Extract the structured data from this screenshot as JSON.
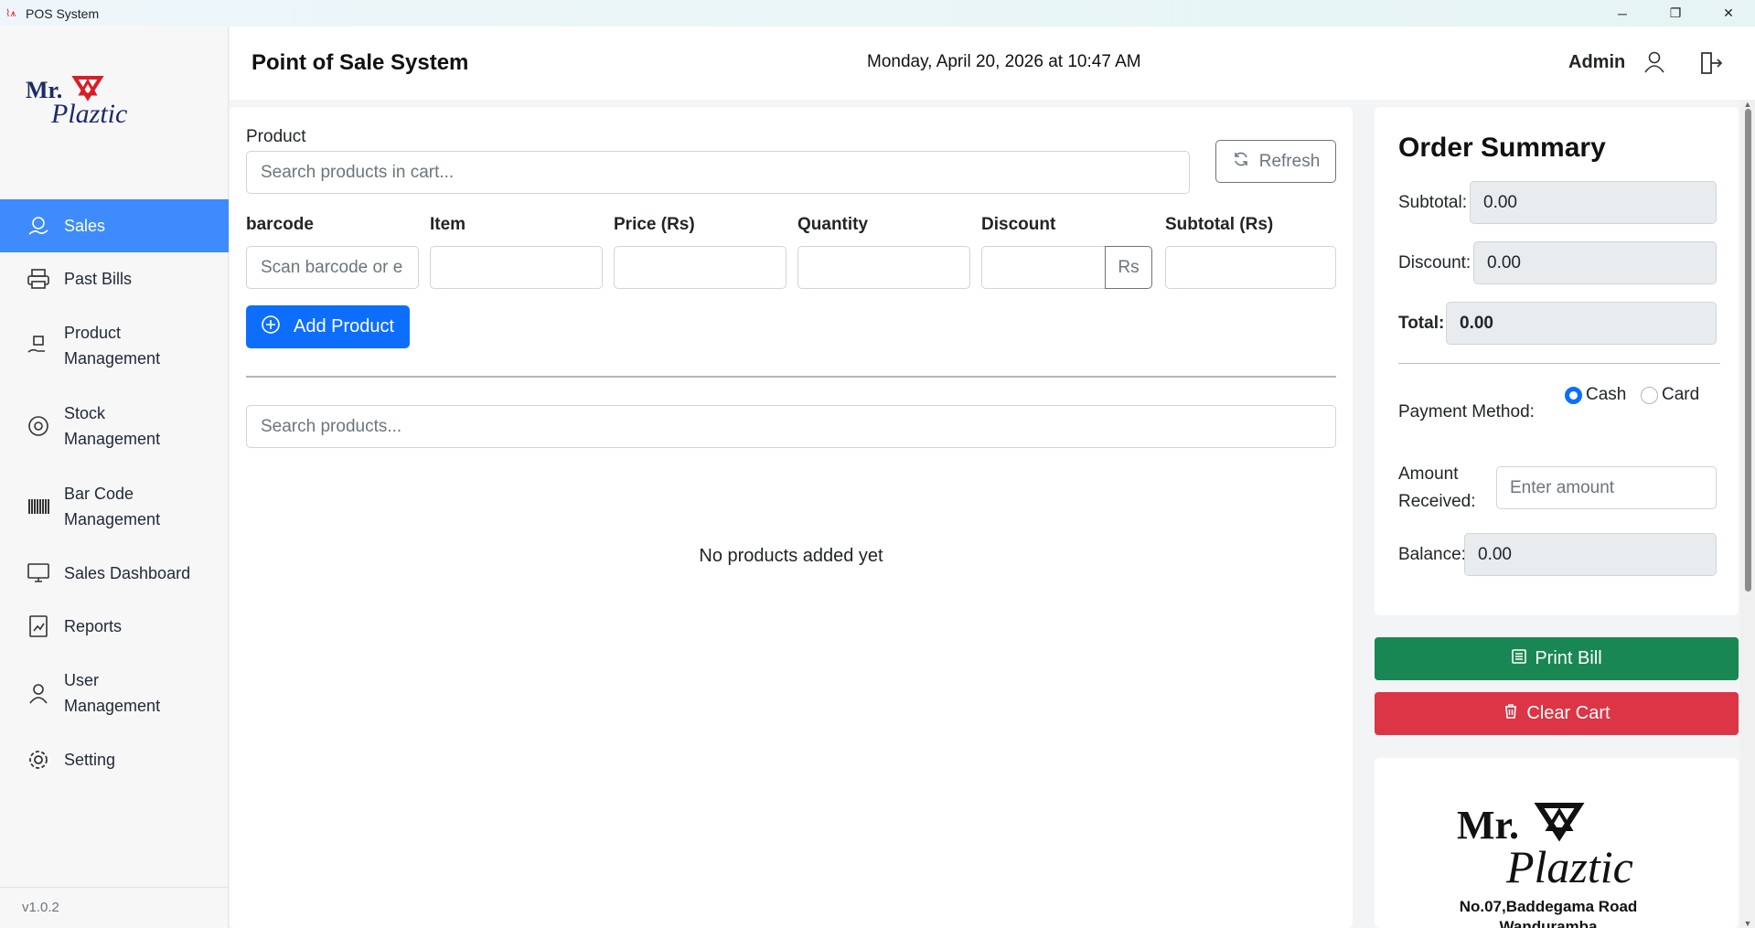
{
  "window": {
    "title": "POS System",
    "minimize": "─",
    "maximize": "❐",
    "close": "✕"
  },
  "sidebar": {
    "brand_top": "Mr.",
    "brand_bottom": "Plaztic",
    "items": [
      {
        "label": "Sales",
        "icon": "sales-icon",
        "active": true
      },
      {
        "label": "Past Bills",
        "icon": "printer-icon"
      },
      {
        "label": "Product\nManagement",
        "icon": "product-icon"
      },
      {
        "label": "Stock\nManagement",
        "icon": "stock-icon"
      },
      {
        "label": "Bar Code\nManagement",
        "icon": "barcode-icon"
      },
      {
        "label": "Sales Dashboard",
        "icon": "dashboard-icon"
      },
      {
        "label": "Reports",
        "icon": "reports-icon"
      },
      {
        "label": "User\nManagement",
        "icon": "users-icon"
      },
      {
        "label": "Setting",
        "icon": "gear-icon"
      }
    ],
    "version": "v1.0.2"
  },
  "header": {
    "title": "Point of Sale System",
    "datetime": "Monday, April 20, 2026 at 10:47 AM",
    "user": "Admin"
  },
  "main": {
    "product_label": "Product",
    "product_search_placeholder": "Search products in cart...",
    "refresh_label": "Refresh",
    "columns": {
      "barcode": "barcode",
      "item": "Item",
      "price": "Price (Rs)",
      "quantity": "Quantity",
      "discount": "Discount",
      "subtotal": "Subtotal (Rs)"
    },
    "barcode_placeholder": "Scan barcode or e",
    "discount_unit": "Rs",
    "add_product_label": "Add Product",
    "search_products_placeholder": "Search products...",
    "empty_message": "No products added yet"
  },
  "summary": {
    "title": "Order Summary",
    "subtotal_label": "Subtotal:",
    "subtotal_value": "0.00",
    "discount_label": "Discount:",
    "discount_value": "0.00",
    "total_label": "Total:",
    "total_value": "0.00",
    "payment_label": "Payment Method:",
    "payment_options": [
      "Cash",
      "Card"
    ],
    "payment_selected": "Cash",
    "amount_label_1": "Amount",
    "amount_label_2": "Received:",
    "amount_placeholder": "Enter amount",
    "balance_label": "Balance:",
    "balance_value": "0.00"
  },
  "actions": {
    "print_label": "Print Bill",
    "clear_label": "Clear Cart"
  },
  "store": {
    "logo_top": "Mr.",
    "logo_bottom": "Plaztic",
    "address_line1": "No.07,Baddegama Road",
    "address_line2": "Wanduramba"
  },
  "colors": {
    "primary": "#0d6efd",
    "active_nav": "#3d8bfd",
    "success": "#198754",
    "danger": "#dc3545",
    "brand_red": "#d61f26",
    "brand_navy": "#1b2a6b"
  }
}
